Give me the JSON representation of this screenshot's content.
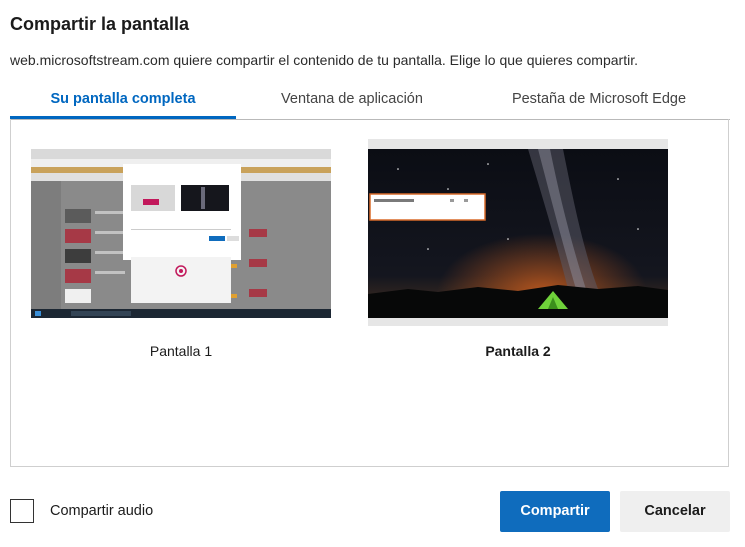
{
  "dialog": {
    "title": "Compartir la pantalla",
    "subtitle": "web.microsoftstream.com quiere compartir el contenido de tu pantalla. Elige lo que quieres compartir."
  },
  "tabs": [
    {
      "label": "Su pantalla completa",
      "active": true
    },
    {
      "label": "Ventana de aplicación",
      "active": false
    },
    {
      "label": "Pestaña de Microsoft Edge",
      "active": false
    }
  ],
  "screens": [
    {
      "label": "Pantalla 1",
      "selected": false
    },
    {
      "label": "Pantalla 2",
      "selected": true
    }
  ],
  "footer": {
    "audio_label": "Compartir audio",
    "audio_checked": false,
    "share_label": "Compartir",
    "cancel_label": "Cancelar"
  },
  "colors": {
    "accent": "#0067c0",
    "primary_button": "#0f6cbd"
  }
}
